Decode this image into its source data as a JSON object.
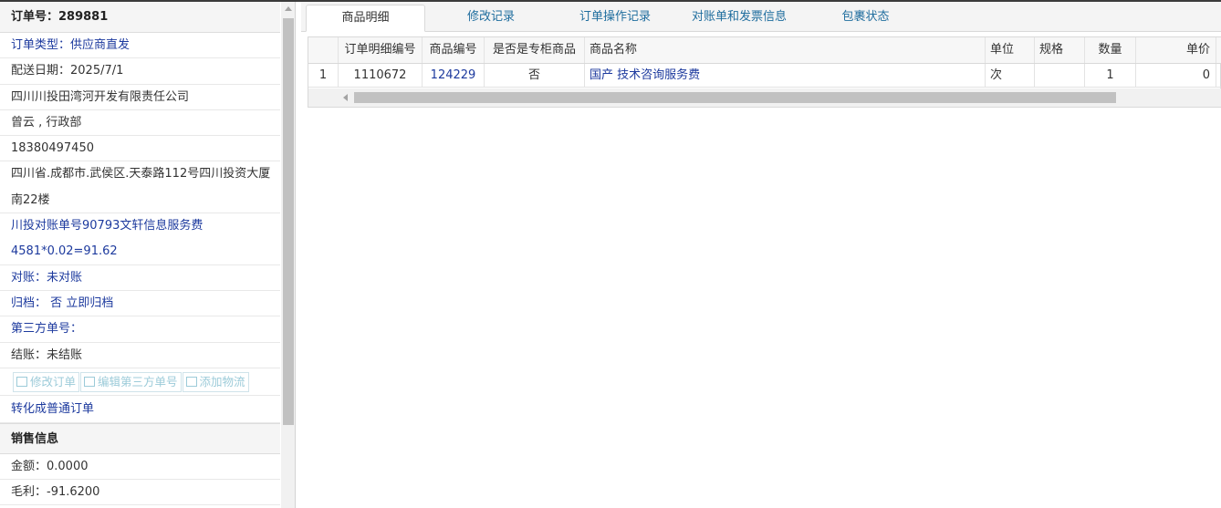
{
  "order": {
    "number_label": "订单号：289881",
    "type": "订单类型：供应商直发",
    "delivery_date": "配送日期：2025/7/1",
    "company": "四川川投田湾河开发有限责任公司",
    "contact": "曾云 , 行政部",
    "phone": "18380497450",
    "address_line1": "四川省.成都市.武侯区.天泰路112号四川投资大厦",
    "address_line2": "南22楼",
    "remark_line1": "川投对账单号90793文轩信息服务费",
    "remark_line2": "4581*0.02=91.62",
    "reconcile": "对账：未对账",
    "archive_label": "归档：",
    "archive_value": "否",
    "archive_link": "立即归档",
    "third_party": "第三方单号：",
    "settle": "结账：未结账",
    "buttons": {
      "edit_order": "修改订单",
      "edit_third_party": "编辑第三方单号",
      "add_logistics": "添加物流"
    },
    "convert_link": "转化成普通订单"
  },
  "sales": {
    "header": "销售信息",
    "amount": "金额：0.0000",
    "profit": "毛利：-91.6200"
  },
  "tabs": [
    {
      "label": "商品明细",
      "active": true
    },
    {
      "label": "修改记录",
      "active": false
    },
    {
      "label": "订单操作记录",
      "active": false
    },
    {
      "label": "对账单和发票信息",
      "active": false
    },
    {
      "label": "包裹状态",
      "active": false
    }
  ],
  "grid": {
    "columns": [
      "订单明细编号",
      "商品编号",
      "是否是专柜商品",
      "商品名称",
      "单位",
      "规格",
      "数量",
      "单价"
    ],
    "rows": [
      {
        "index": "1",
        "detail_id": "1110672",
        "product_id": "124229",
        "is_counter": "否",
        "name": "国产 技术咨询服务费",
        "unit": "次",
        "spec": "",
        "qty": "1",
        "price": "0"
      }
    ]
  },
  "icons": {
    "edit": "edit-icon",
    "scroll_up": "scroll-up-arrow-icon",
    "scroll_left": "scroll-left-arrow-icon"
  }
}
